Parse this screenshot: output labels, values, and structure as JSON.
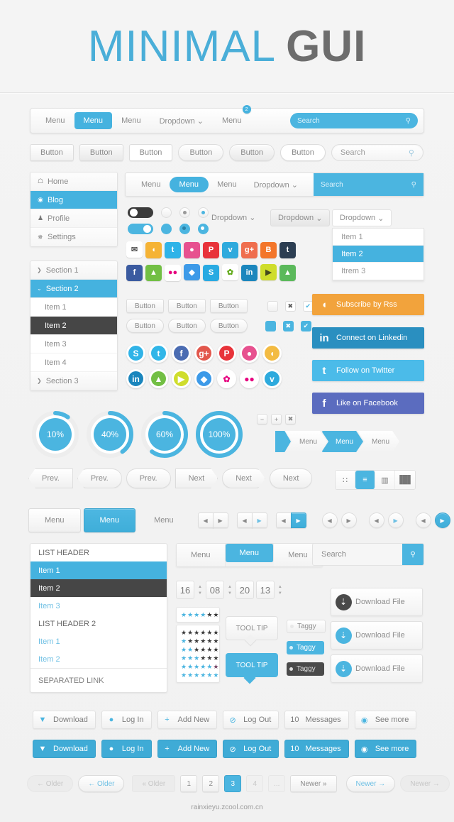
{
  "header": {
    "title_a": "MINIMAL",
    "title_b": "GUI"
  },
  "navbar1": {
    "items": [
      {
        "label": "Menu",
        "active": false
      },
      {
        "label": "Menu",
        "active": true
      },
      {
        "label": "Menu",
        "active": false
      },
      {
        "label": "Dropdown",
        "active": false,
        "caret": "⌄"
      },
      {
        "label": "Menu",
        "active": false,
        "badge": "2"
      }
    ],
    "search_placeholder": "Search",
    "search_icon": "search-icon"
  },
  "buttons_row": {
    "labels": [
      "Button",
      "Button",
      "Button",
      "Button",
      "Button",
      "Button"
    ],
    "search_placeholder": "Search"
  },
  "sidebar": {
    "items": [
      {
        "label": "Home",
        "icon": "home-icon",
        "selected": false
      },
      {
        "label": "Blog",
        "icon": "blog-icon",
        "selected": true
      },
      {
        "label": "Profile",
        "icon": "user-icon",
        "selected": false
      },
      {
        "label": "Settings",
        "icon": "gear-icon",
        "selected": false
      }
    ]
  },
  "accordion": {
    "rows": [
      {
        "label": "Section 1",
        "type": "section",
        "selected": false,
        "arrow": "❯"
      },
      {
        "label": "Section 2",
        "type": "section",
        "selected": true,
        "arrow": "⌄"
      },
      {
        "label": "Item 1",
        "type": "item",
        "state": "normal"
      },
      {
        "label": "Item 2",
        "type": "item",
        "state": "dark"
      },
      {
        "label": "Item 3",
        "type": "item",
        "state": "normal"
      },
      {
        "label": "Item 4",
        "type": "item",
        "state": "normal"
      },
      {
        "label": "Section 3",
        "type": "section",
        "selected": false,
        "arrow": "❯"
      }
    ]
  },
  "navbar2": {
    "items": [
      {
        "label": "Menu",
        "active": false
      },
      {
        "label": "Menu",
        "active": true
      },
      {
        "label": "Menu",
        "active": false
      },
      {
        "label": "Dropdown",
        "active": false,
        "caret": "⌄"
      }
    ],
    "search_placeholder": "Search"
  },
  "dropdowns": {
    "plain_label": "Dropdown",
    "gray_label": "Dropdown",
    "white_label": "Dropdown",
    "caret": "⌄",
    "menu_items": [
      {
        "label": "Item 1",
        "selected": false
      },
      {
        "label": "Item 2",
        "selected": true
      },
      {
        "label": "Itrem 3",
        "selected": false
      }
    ]
  },
  "social_squares_row1": [
    {
      "name": "mail-icon",
      "glyph": "✉",
      "color": "#ffffff",
      "fg": "#555555"
    },
    {
      "name": "rss-icon",
      "glyph": "◖",
      "color": "#f5b335",
      "fg": "#ffffff"
    },
    {
      "name": "twitter-icon",
      "glyph": "t",
      "color": "#2eb3e8",
      "fg": "#ffffff"
    },
    {
      "name": "dribbble-icon",
      "glyph": "●",
      "color": "#e7518f",
      "fg": "#ffffff"
    },
    {
      "name": "pinterest-icon",
      "glyph": "P",
      "color": "#e8333a",
      "fg": "#ffffff"
    },
    {
      "name": "vimeo-icon",
      "glyph": "v",
      "color": "#2eaadd",
      "fg": "#ffffff"
    },
    {
      "name": "googleplus-icon",
      "glyph": "g+",
      "color": "#ef6e4e",
      "fg": "#ffffff"
    },
    {
      "name": "blogger-icon",
      "glyph": "B",
      "color": "#f3762a",
      "fg": "#ffffff"
    },
    {
      "name": "tumblr-icon",
      "glyph": "t",
      "color": "#2c3e52",
      "fg": "#ffffff"
    }
  ],
  "social_squares_row2": [
    {
      "name": "facebook-icon",
      "glyph": "f",
      "color": "#3b5ba0",
      "fg": "#ffffff"
    },
    {
      "name": "evernote-icon",
      "glyph": "▲",
      "color": "#72bf44",
      "fg": "#ffffff"
    },
    {
      "name": "flickr-icon",
      "glyph": "●●",
      "color": "#ffffff",
      "fg": "#e6007e"
    },
    {
      "name": "dropbox-icon",
      "glyph": "◆",
      "color": "#3d9ae8",
      "fg": "#ffffff"
    },
    {
      "name": "skype-icon",
      "glyph": "S",
      "color": "#29aae2",
      "fg": "#ffffff"
    },
    {
      "name": "picasa-icon",
      "glyph": "✿",
      "color": "#ffffff",
      "fg": "#60a917"
    },
    {
      "name": "linkedin-icon",
      "glyph": "in",
      "color": "#1b86bd",
      "fg": "#ffffff"
    },
    {
      "name": "delicious-icon",
      "glyph": "▶",
      "color": "#cfdd2c",
      "fg": "#44491e"
    },
    {
      "name": "forrst-icon",
      "glyph": "▲",
      "color": "#5bb95b",
      "fg": "#ffffff"
    }
  ],
  "small_buttons": {
    "row1": [
      "Button",
      "Button",
      "Button"
    ],
    "row2": [
      "Button",
      "Button",
      "Button"
    ],
    "checkbox_glyphs": {
      "x": "✖",
      "check": "✔"
    }
  },
  "social_circles_row1": [
    {
      "name": "skype-icon",
      "glyph": "S",
      "color": "#30b3e7"
    },
    {
      "name": "twitter-icon",
      "glyph": "t",
      "color": "#31b6e8"
    },
    {
      "name": "facebook-icon",
      "glyph": "f",
      "color": "#4b6cb2"
    },
    {
      "name": "googleplus-icon",
      "glyph": "g+",
      "color": "#e2574c"
    },
    {
      "name": "pinterest-icon",
      "glyph": "P",
      "color": "#e8333a"
    },
    {
      "name": "dribbble-icon",
      "glyph": "●",
      "color": "#e7518f"
    },
    {
      "name": "rss-icon",
      "glyph": "◖",
      "color": "#f3bb42"
    }
  ],
  "social_circles_row2": [
    {
      "name": "linkedin-icon",
      "glyph": "in",
      "color": "#1b86bd"
    },
    {
      "name": "evernote-icon",
      "glyph": "▲",
      "color": "#72bf44"
    },
    {
      "name": "delicious-icon",
      "glyph": "▶",
      "color": "#cfdd2c"
    },
    {
      "name": "dropbox-icon",
      "glyph": "◆",
      "color": "#3d9ae8"
    },
    {
      "name": "picasa-icon",
      "glyph": "✿",
      "color": "#ffffff"
    },
    {
      "name": "flickr-icon",
      "glyph": "●●",
      "color": "#ffffff"
    },
    {
      "name": "vimeo-icon",
      "glyph": "v",
      "color": "#2eaadd"
    }
  ],
  "cta_buttons": [
    {
      "label": "Subscribe by Rss",
      "icon": "rss-icon",
      "glyph": "◖",
      "color": "#f2a33c"
    },
    {
      "label": "Connect on Linkedin",
      "icon": "linkedin-icon",
      "glyph": "in",
      "color": "#2a8fc0"
    },
    {
      "label": "Follow on Twitter",
      "icon": "twitter-icon",
      "glyph": "t",
      "color": "#4bbbe9"
    },
    {
      "label": "Like on Facebook",
      "icon": "facebook-icon",
      "glyph": "f",
      "color": "#5b6cbf"
    }
  ],
  "progress_circles": [
    {
      "label": "10%",
      "value": 10
    },
    {
      "label": "40%",
      "value": 40
    },
    {
      "label": "60%",
      "value": 60
    },
    {
      "label": "100%",
      "value": 100
    }
  ],
  "mini_buttons": [
    "−",
    "+",
    "✖"
  ],
  "breadcrumbs": [
    {
      "label": "Menu",
      "active": false
    },
    {
      "label": "Menu",
      "active": true
    },
    {
      "label": "Menu",
      "active": false
    }
  ],
  "prev_next": {
    "prev_labels": [
      "Prev.",
      "Prev.",
      "Prev."
    ],
    "next_labels": [
      "Next",
      "Next",
      "Next"
    ]
  },
  "view_toggle": [
    {
      "name": "grid-view-icon",
      "glyph": "∷",
      "active": false
    },
    {
      "name": "list-view-icon",
      "glyph": "≡",
      "active": true
    },
    {
      "name": "column-view-icon",
      "glyph": "▥",
      "active": false
    },
    {
      "name": "detail-view-icon",
      "glyph": "▐█▌",
      "active": false
    }
  ],
  "tabs_row": [
    {
      "label": "Menu",
      "style": "light"
    },
    {
      "label": "Menu",
      "style": "blue"
    },
    {
      "label": "Menu",
      "style": "plain"
    }
  ],
  "arrow_pairs": {
    "left_glyph": "◀",
    "right_glyph": "▶"
  },
  "list_box": {
    "rows": [
      {
        "label": "LIST HEADER",
        "style": "hdr"
      },
      {
        "label": "Item 1",
        "style": "sel"
      },
      {
        "label": "Item 2",
        "style": "dark"
      },
      {
        "label": "Item 3",
        "style": "link"
      },
      {
        "label": "LIST HEADER 2",
        "style": "hdr"
      },
      {
        "label": "Item 1",
        "style": "link"
      },
      {
        "label": "Item 2",
        "style": "link"
      },
      {
        "label": "SEPARATED LINK",
        "style": "sep"
      }
    ]
  },
  "tabs2": [
    {
      "label": "Menu",
      "active": false
    },
    {
      "label": "Menu",
      "active": true
    },
    {
      "label": "Menu",
      "active": false
    }
  ],
  "search2": {
    "placeholder": "Search",
    "button_icon": "search-icon"
  },
  "time_stepper": {
    "values": [
      "16",
      "08",
      "20",
      "13"
    ],
    "separator_up": "▲",
    "separator_down": "▼"
  },
  "star_rating": {
    "top": {
      "filled": 4,
      "dark": 2,
      "total": 6
    },
    "rows": [
      {
        "on": 0,
        "dark": 6
      },
      {
        "on": 1,
        "dark": 5
      },
      {
        "on": 2,
        "dark": 4
      },
      {
        "on": 3,
        "dark": 3
      },
      {
        "on": 5,
        "dark": 1
      },
      {
        "on": 6,
        "dark": 0
      }
    ]
  },
  "tooltips": [
    {
      "label": "TOOL TIP",
      "style": "light"
    },
    {
      "label": "TOOL TIP",
      "style": "blue"
    }
  ],
  "taggies": [
    {
      "label": "Taggy",
      "style": "light"
    },
    {
      "label": "Taggy",
      "style": "blue"
    },
    {
      "label": "Taggy",
      "style": "dark"
    }
  ],
  "download_files": [
    {
      "label": "Download File",
      "color": "#4a4a4a"
    },
    {
      "label": "Download File",
      "color": "#4bb5e0"
    },
    {
      "label": "Download File",
      "color": "#4bb5e0"
    }
  ],
  "action_buttons": [
    {
      "label": "Download",
      "icon": "download-icon",
      "glyph": "▼",
      "num": null
    },
    {
      "label": "Log In",
      "icon": "user-icon",
      "glyph": "●",
      "num": null
    },
    {
      "label": "Add New",
      "icon": "plus-icon",
      "glyph": "+",
      "num": null
    },
    {
      "label": "Log Out",
      "icon": "power-icon",
      "glyph": "⊘",
      "num": null
    },
    {
      "label": "Messages",
      "icon": "count-badge",
      "glyph": "",
      "num": "10"
    },
    {
      "label": "See more",
      "icon": "eye-icon",
      "glyph": "◉",
      "num": null
    }
  ],
  "pagination": {
    "older_disabled": "← Older",
    "older_normal": "← Older",
    "older_flat": "« Older",
    "pages": [
      {
        "label": "1",
        "state": "normal"
      },
      {
        "label": "2",
        "state": "normal"
      },
      {
        "label": "3",
        "state": "active"
      },
      {
        "label": "4",
        "state": "dim"
      },
      {
        "label": "...",
        "state": "dim"
      }
    ],
    "newer_flat": "Newer »",
    "newer_normal": "Newer →",
    "newer_disabled": "Newer →"
  },
  "footer": {
    "text": "rainxieyu.zcool.com.cn"
  },
  "colors": {
    "accent": "#4bb5e0",
    "dark": "#464646",
    "bg": "#f2f2f2"
  }
}
